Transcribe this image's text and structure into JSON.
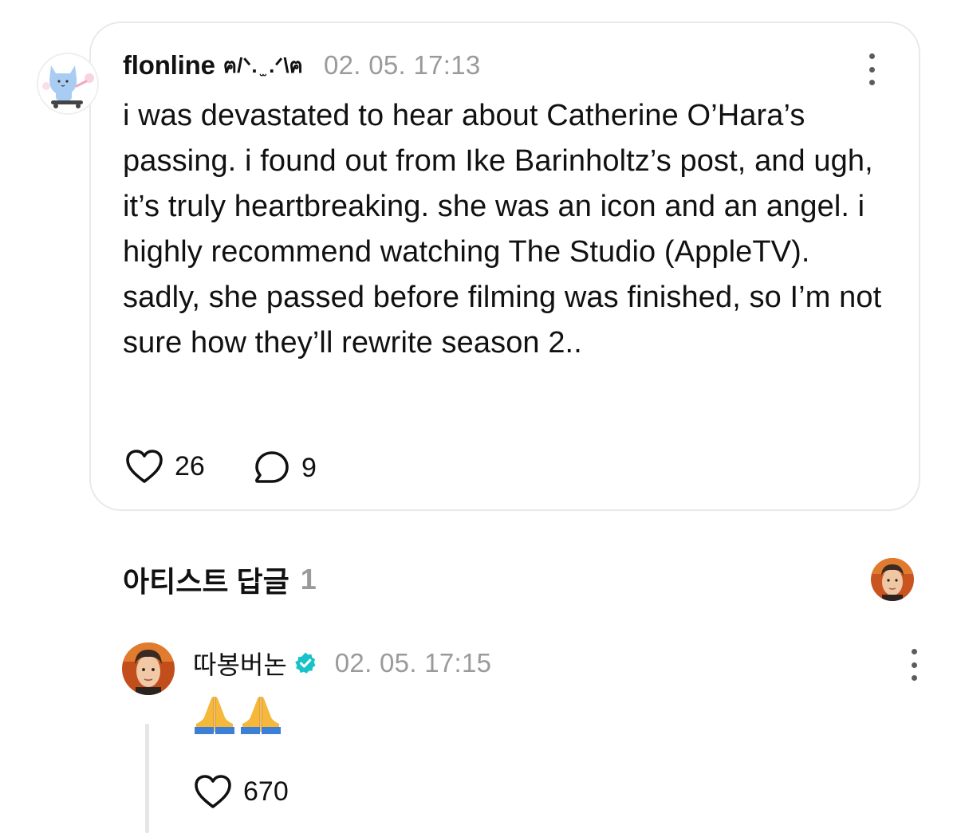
{
  "post": {
    "username": "flonline",
    "username_deco": "ฅ/ᐠ. ̫ .ᐟ\\ฅ",
    "timestamp": "02. 05. 17:13",
    "body": "i was devastated to hear about Catherine O’Hara’s passing. i found out from Ike Barinholtz’s post, and ugh, it’s truly heartbreaking. she was an icon and an angel. i highly recommend watching The Studio (AppleTV). sadly, she passed before filming was finished, so I’m not sure how they’ll rewrite season 2..",
    "like_count": "26",
    "comment_count": "9",
    "avatar_icon": "cat-skateboard-avatar",
    "accent_avatar_color": "#a9cdf2"
  },
  "artist_replies": {
    "title": "아티스트 답글",
    "count": "1"
  },
  "reply": {
    "name": "따봉버논",
    "verified_color": "#19c2c8",
    "timestamp": "02. 05. 17:15",
    "emoji_count": 2,
    "emoji_icon": "folded-hands-icon",
    "like_count": "670"
  }
}
